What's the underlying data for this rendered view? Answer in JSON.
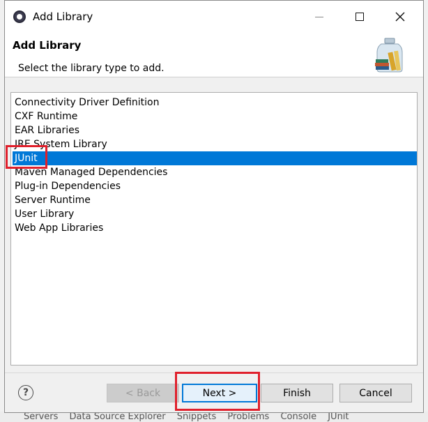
{
  "window": {
    "title": "Add Library"
  },
  "header": {
    "title": "Add Library",
    "subtitle": "Select the library type to add."
  },
  "library_types": [
    {
      "label": "Connectivity Driver Definition",
      "selected": false
    },
    {
      "label": "CXF Runtime",
      "selected": false
    },
    {
      "label": "EAR Libraries",
      "selected": false
    },
    {
      "label": "JRE System Library",
      "selected": false
    },
    {
      "label": "JUnit",
      "selected": true
    },
    {
      "label": "Maven Managed Dependencies",
      "selected": false
    },
    {
      "label": "Plug-in Dependencies",
      "selected": false
    },
    {
      "label": "Server Runtime",
      "selected": false
    },
    {
      "label": "User Library",
      "selected": false
    },
    {
      "label": "Web App Libraries",
      "selected": false
    }
  ],
  "buttons": {
    "help": "?",
    "back": "< Back",
    "next": "Next >",
    "finish": "Finish",
    "cancel": "Cancel"
  },
  "background_tabs": [
    "Servers",
    "Data Source Explorer",
    "Snippets",
    "Problems",
    "Console",
    "JUnit"
  ],
  "colors": {
    "selection": "#0078d7",
    "highlight": "#e0202c"
  },
  "icons": {
    "app": "eclipse-icon",
    "header": "library-jar-icon"
  }
}
